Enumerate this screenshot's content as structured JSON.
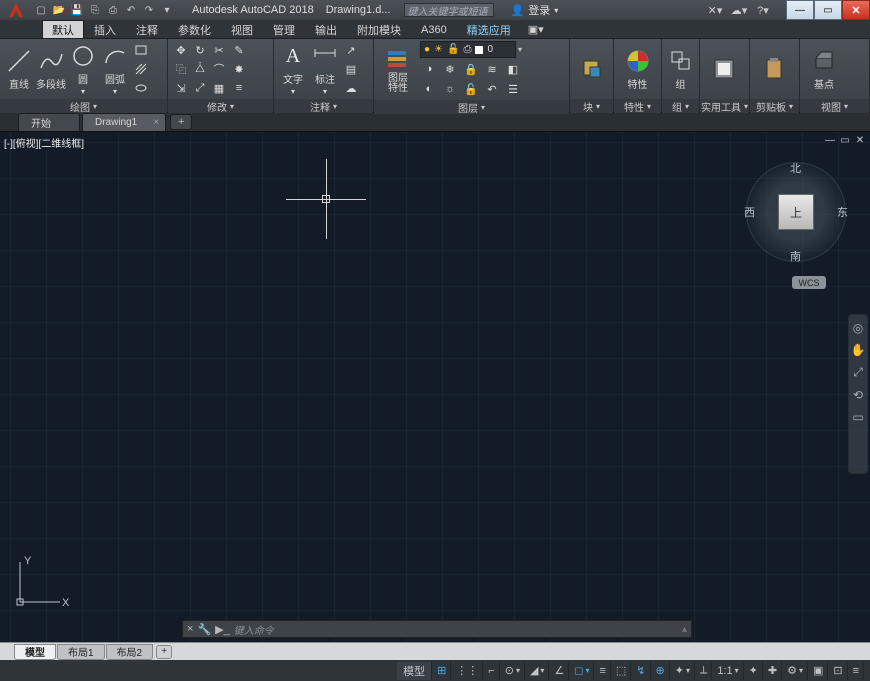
{
  "titlebar": {
    "app_name": "Autodesk AutoCAD 2018",
    "doc_name": "Drawing1.d...",
    "search_placeholder": "键入关键字或短语",
    "login_label": "登录"
  },
  "ribbon_tabs": [
    "默认",
    "插入",
    "注释",
    "参数化",
    "视图",
    "管理",
    "输出",
    "附加模块",
    "A360",
    "精选应用"
  ],
  "ribbon": {
    "draw": {
      "title": "绘图",
      "line": "直线",
      "pline": "多段线",
      "circle": "圆",
      "arc": "圆弧"
    },
    "modify": {
      "title": "修改"
    },
    "annotate": {
      "title": "注释",
      "text": "文字",
      "dim": "标注"
    },
    "layers": {
      "title": "图层",
      "props": "图层\n特性",
      "current": "0"
    },
    "block": {
      "title": "块"
    },
    "props": {
      "title": "特性"
    },
    "group": {
      "title": "组"
    },
    "utils": {
      "title": "实用工具"
    },
    "clipboard": {
      "title": "剪贴板"
    },
    "view": {
      "title": "视图",
      "base": "基点"
    }
  },
  "file_tabs": {
    "start": "开始",
    "drawing": "Drawing1"
  },
  "viewport": {
    "label": "[-][俯视][二维线框]",
    "cube": {
      "n": "北",
      "s": "南",
      "e": "东",
      "w": "西",
      "top": "上"
    },
    "wcs": "WCS",
    "ucs": {
      "x": "X",
      "y": "Y"
    }
  },
  "cmdline": {
    "prompt": "键入命令"
  },
  "layout_tabs": {
    "model": "模型",
    "l1": "布局1",
    "l2": "布局2"
  },
  "statusbar": {
    "model": "模型",
    "scale": "1:1"
  }
}
